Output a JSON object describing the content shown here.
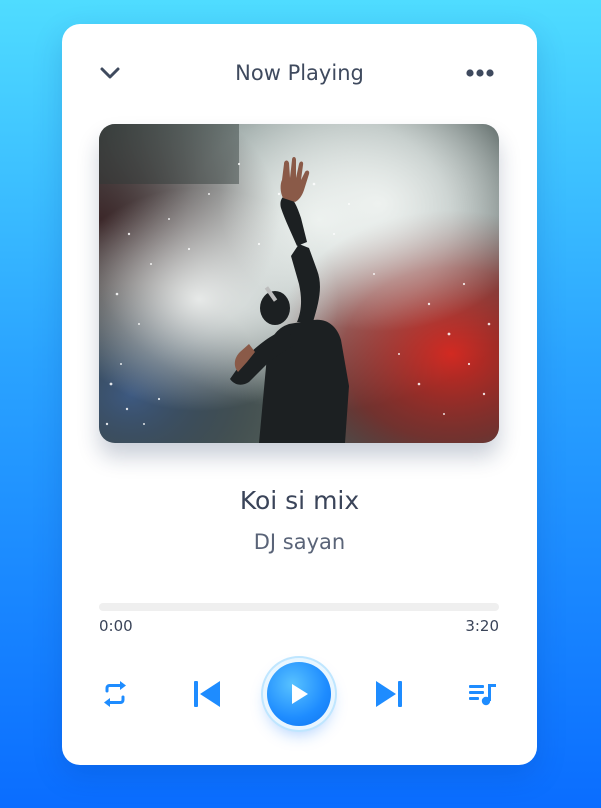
{
  "header": {
    "title": "Now Playing",
    "collapse_icon": "chevron-down-icon",
    "more_icon": "more-horizontal-icon"
  },
  "track": {
    "title": "Koi si mix",
    "artist": "DJ sayan",
    "artwork": "concert-performer-smoke-image"
  },
  "progress": {
    "current_time": "0:00",
    "total_time": "3:20",
    "fraction": 0
  },
  "controls": {
    "repeat_icon": "repeat-icon",
    "previous_icon": "skip-previous-icon",
    "play_icon": "play-icon",
    "next_icon": "skip-next-icon",
    "playlist_icon": "playlist-icon"
  },
  "colors": {
    "accent": "#1e8cff",
    "text_primary": "#3a4459",
    "background_top": "#4fdcff",
    "background_bottom": "#0a6dff"
  }
}
